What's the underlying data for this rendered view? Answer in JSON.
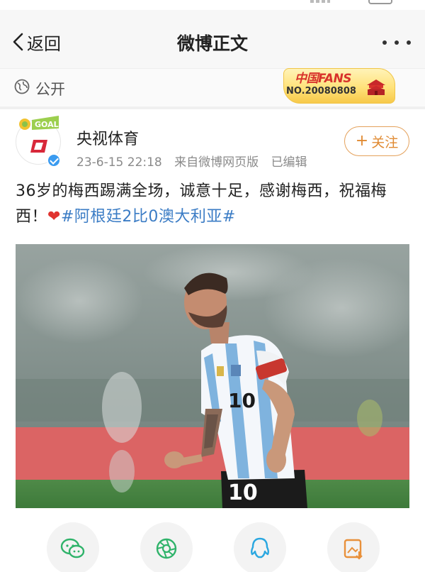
{
  "nav": {
    "back_label": "返回",
    "title": "微博正文"
  },
  "visibility": {
    "label": "公开"
  },
  "fans_badge": {
    "title": "中国FANS",
    "number": "NO.20080808"
  },
  "post": {
    "author": "央视体育",
    "date": "23-6-15 22:18",
    "source": "来自微博网页版",
    "edited": "已编辑",
    "follow_label": "关注",
    "text_main": "36岁的梅西踢满全场，诚意十足，感谢梅西，祝福梅西！",
    "heart": "❤",
    "hashtag": "#阿根廷2比0澳大利亚#",
    "jersey_number": "10",
    "shorts_number": "10"
  },
  "share": {
    "icons": [
      "wechat-icon",
      "moments-icon",
      "qq-icon",
      "save-image-icon"
    ]
  },
  "colors": {
    "accent_orange": "#e08a32",
    "link_blue": "#3b7cc5",
    "heart_red": "#e0332f",
    "verify_blue": "#3a9bf0"
  }
}
